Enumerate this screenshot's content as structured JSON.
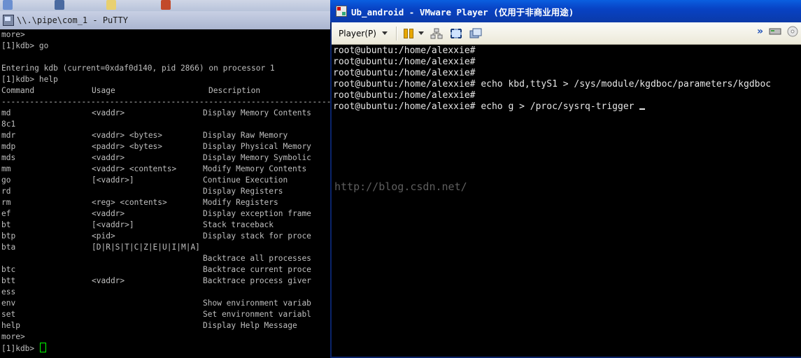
{
  "putty": {
    "title": "\\\\.\\pipe\\com_1 - PuTTY",
    "icon": "putty-icon",
    "lines_top": [
      "more>",
      "[1]kdb> go",
      "",
      "Entering kdb (current=0xdaf0d140, pid 2866) on processor 1 ",
      "[1]kdb> help"
    ],
    "table_header": {
      "command": "Command",
      "usage": "Usage",
      "description": "Description"
    },
    "separator": "----------------------------------------------------------------------",
    "commands": [
      {
        "cmd": "md",
        "usage": "<vaddr>",
        "desc": "Display Memory Contents"
      },
      {
        "cmd": "8c1",
        "usage": "",
        "desc": ""
      },
      {
        "cmd": "mdr",
        "usage": "<vaddr> <bytes>",
        "desc": "Display Raw Memory"
      },
      {
        "cmd": "mdp",
        "usage": "<paddr> <bytes>",
        "desc": "Display Physical Memory"
      },
      {
        "cmd": "mds",
        "usage": "<vaddr>",
        "desc": "Display Memory Symbolic"
      },
      {
        "cmd": "mm",
        "usage": "<vaddr> <contents>",
        "desc": "Modify Memory Contents"
      },
      {
        "cmd": "go",
        "usage": "[<vaddr>]",
        "desc": "Continue Execution"
      },
      {
        "cmd": "rd",
        "usage": "",
        "desc": "Display Registers"
      },
      {
        "cmd": "rm",
        "usage": "<reg> <contents>",
        "desc": "Modify Registers"
      },
      {
        "cmd": "ef",
        "usage": "<vaddr>",
        "desc": "Display exception frame"
      },
      {
        "cmd": "bt",
        "usage": "[<vaddr>]",
        "desc": "Stack traceback"
      },
      {
        "cmd": "btp",
        "usage": "<pid>",
        "desc": "Display stack for proce"
      },
      {
        "cmd": "bta",
        "usage": "[D|R|S|T|C|Z|E|U|I|M|A]",
        "desc": ""
      },
      {
        "cmd": "",
        "usage": "",
        "desc": "Backtrace all processes"
      },
      {
        "cmd": "btc",
        "usage": "",
        "desc": "Backtrace current proce"
      },
      {
        "cmd": "btt",
        "usage": "<vaddr>",
        "desc": "Backtrace process giver"
      },
      {
        "cmd": "ess",
        "usage": "",
        "desc": ""
      },
      {
        "cmd": "env",
        "usage": "",
        "desc": "Show environment variab"
      },
      {
        "cmd": "set",
        "usage": "",
        "desc": "Set environment variabl"
      },
      {
        "cmd": "help",
        "usage": "",
        "desc": "Display Help Message"
      }
    ],
    "lines_bottom": [
      "more>"
    ],
    "prompt": "[1]kdb> ",
    "cursor_color": "#00ff00"
  },
  "vmware": {
    "title": "Ub_android - VMware Player (仅用于非商业用途)",
    "icon": "vmware-icon",
    "toolbar": {
      "player_menu_label": "Player(P)",
      "icons": [
        "pause-icon",
        "network-icon",
        "fullscreen-icon",
        "unity-icon",
        "more-icon",
        "removable-device-icon",
        "disc-icon"
      ]
    },
    "terminal_lines": [
      "root@ubuntu:/home/alexxie#",
      "root@ubuntu:/home/alexxie#",
      "root@ubuntu:/home/alexxie#",
      "root@ubuntu:/home/alexxie# echo kbd,ttyS1 > /sys/module/kgdboc/parameters/kgdboc",
      "root@ubuntu:/home/alexxie#",
      "root@ubuntu:/home/alexxie# echo g > /proc/sysrq-trigger "
    ],
    "watermark": "http://blog.csdn.net/"
  },
  "colors": {
    "putty_text": "#bfbfbf",
    "vmware_titlebar": "#0842c4",
    "vm_text": "#e6e6e6"
  }
}
